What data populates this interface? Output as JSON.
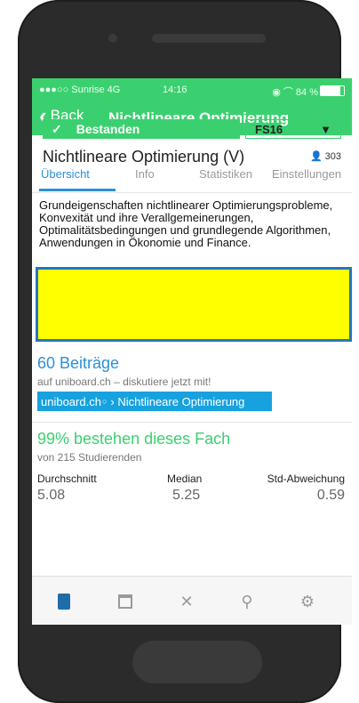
{
  "statusbar": {
    "carrier": "●●●○○ Sunrise 4G",
    "time": "14:16",
    "indicators": "◉ ⌒ 84 %"
  },
  "navbar": {
    "back_label": "Back",
    "title": "Nichtlineare Optimierung"
  },
  "course": {
    "title": "Nichtlineare Optimierung (V)",
    "participants": "303",
    "status": "Bestanden",
    "semester": "FS16"
  },
  "tabs": [
    {
      "label": "Übersicht"
    },
    {
      "label": "Info"
    },
    {
      "label": "Statistiken"
    },
    {
      "label": "Einstellungen"
    }
  ],
  "description": "Grundeigenschaften nichtlinearer Optimierungsprobleme, Konvexität und ihre Verallgemeinerungen, Optimalitätsbedingungen und grundlegende Algorithmen, Anwendungen in Ökonomie und Finance.",
  "ad": {
    "color": "#ffff00"
  },
  "forum": {
    "count": "60 Beiträge",
    "subtitle": "auf uniboard.ch – diskutiere jetzt mit!",
    "link_brand": "uniboard.ch",
    "link_text": "› Nichtlineare Optimierung"
  },
  "stats": {
    "pass_rate": "99% bestehen dieses Fach",
    "from": "von 215 Studierenden",
    "labels": [
      "Durchschnitt",
      "Median",
      "Std-Abweichung"
    ],
    "values": [
      "5.08",
      "5.25",
      "0.59"
    ]
  },
  "tabbar": {
    "icons": [
      "book-icon",
      "calendar-icon",
      "cutlery-icon",
      "search-icon",
      "gear-icon"
    ]
  },
  "colors": {
    "accent_green": "#3bd06f",
    "accent_blue": "#2b8fd9",
    "link_blue": "#17a2df"
  }
}
